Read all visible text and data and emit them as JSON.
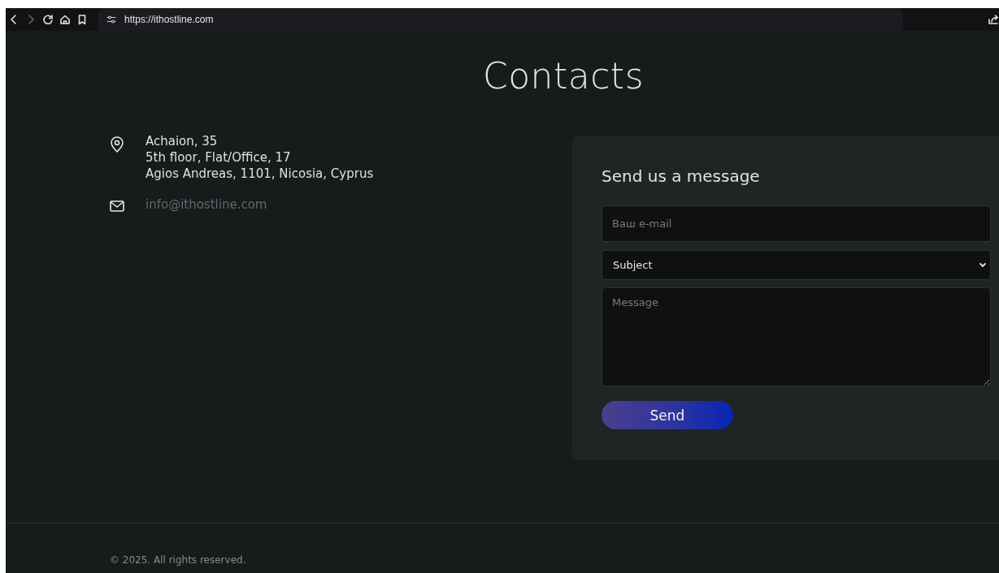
{
  "browser": {
    "url": "https://ithostline.com",
    "back_disabled": false,
    "forward_disabled": true
  },
  "page": {
    "title": "Contacts",
    "address": {
      "lines": [
        "Achaion, 35",
        "5th floor, Flat/Office, 17",
        "Agios Andreas, 1101, Nicosia, Cyprus"
      ]
    },
    "email": "info@ithostline.com",
    "form": {
      "title": "Send us a message",
      "email_placeholder": "Ваш e-mail",
      "subject": "Subject",
      "message_placeholder": "Message",
      "button": "Send"
    }
  },
  "footer": {
    "copyright": "© 2025. All rights reserved."
  }
}
